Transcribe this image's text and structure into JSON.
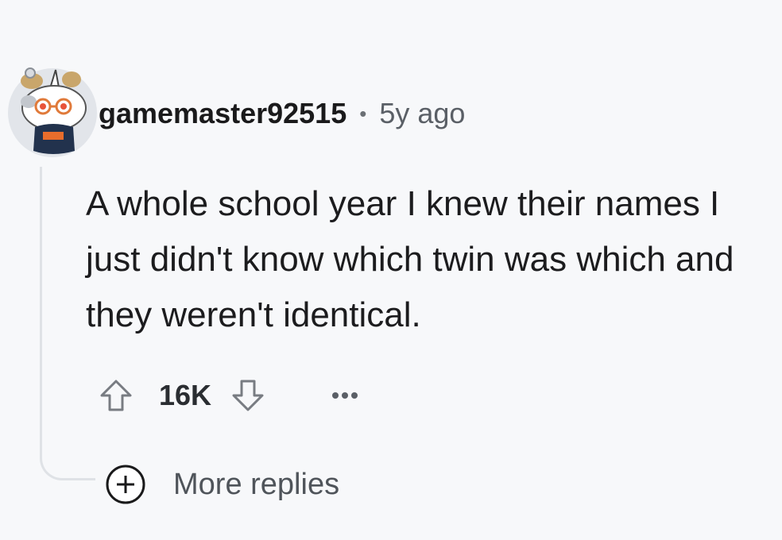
{
  "comment": {
    "author": "gamemaster92515",
    "separator": "•",
    "age": "5y ago",
    "body": "A whole school year I knew their names I just didn't know which twin was which and they weren't identical.",
    "score": "16K",
    "avatar_icon": "snoo-avatar-icon"
  },
  "actions": {
    "upvote_icon": "upvote-arrow-icon",
    "downvote_icon": "downvote-arrow-icon",
    "more_icon": "ellipsis-icon"
  },
  "more_replies": {
    "label": "More replies",
    "icon": "plus-circle-icon"
  },
  "colors": {
    "background": "#f7f8fa",
    "text": "#1a1a1b",
    "muted": "#5a5f66",
    "thread_line": "#dfe2e6"
  }
}
